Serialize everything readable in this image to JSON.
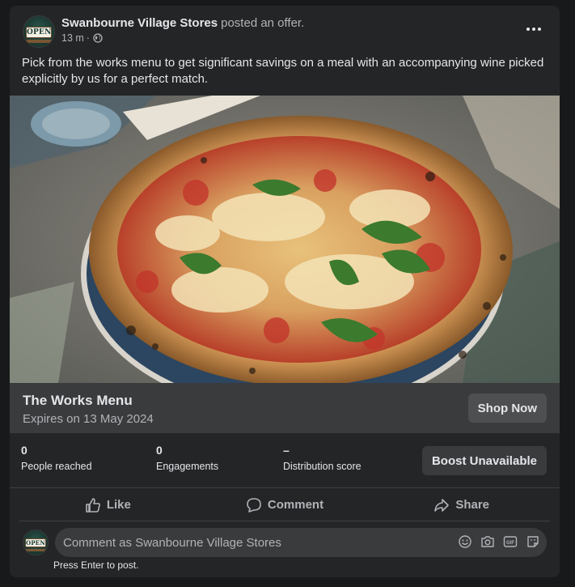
{
  "post": {
    "page_name": "Swanbourne Village Stores",
    "action": "posted an offer.",
    "time": "13 m",
    "separator": "·",
    "avatar_text": "OPEN",
    "more_icon": "more-dots-icon",
    "privacy_icon": "globe-icon",
    "text": "Pick from the works menu to get significant savings on a meal with an accompanying wine picked explicitly by us for a perfect match."
  },
  "offer": {
    "title": "The Works Menu",
    "expires": "Expires on 13 May 2024",
    "button": "Shop Now"
  },
  "stats": {
    "items": [
      {
        "value": "0",
        "label": "People reached"
      },
      {
        "value": "0",
        "label": "Engagements"
      },
      {
        "value": "–",
        "label": "Distribution score"
      }
    ],
    "boost_button": "Boost Unavailable"
  },
  "actions": [
    {
      "label": "Like",
      "icon": "thumbs-up-icon"
    },
    {
      "label": "Comment",
      "icon": "speech-bubble-icon"
    },
    {
      "label": "Share",
      "icon": "share-arrow-icon"
    }
  ],
  "comment": {
    "placeholder": "Comment as Swanbourne Village Stores",
    "hint": "Press Enter to post.",
    "icons": [
      "emoji-icon",
      "camera-icon",
      "gif-icon",
      "sticker-icon"
    ]
  },
  "colors": {
    "background": "#18191a",
    "card": "#242526",
    "offer_bar": "#3a3b3c",
    "text_primary": "#e4e6eb",
    "text_secondary": "#b0b3b8"
  }
}
